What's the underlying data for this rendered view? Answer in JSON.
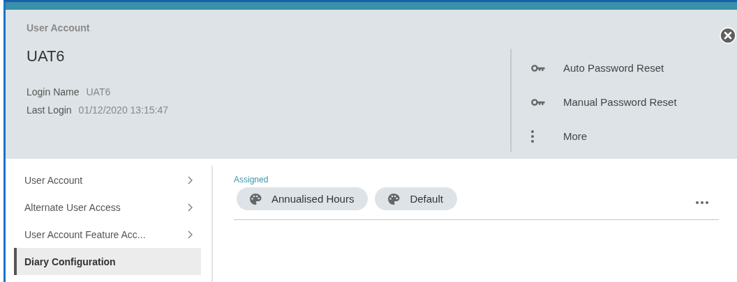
{
  "header": {
    "section": "User Account",
    "name": "UAT6",
    "fields": [
      {
        "label": "Login Name",
        "value": "UAT6"
      },
      {
        "label": "Last Login",
        "value": "01/12/2020 13:15:47"
      }
    ],
    "actions": [
      {
        "kind": "key",
        "label": "Auto Password Reset"
      },
      {
        "kind": "key",
        "label": "Manual Password Reset"
      },
      {
        "kind": "more",
        "label": "More"
      }
    ]
  },
  "sidebar": {
    "items": [
      {
        "label": "User Account",
        "chevron": true,
        "selected": false
      },
      {
        "label": "Alternate User Access",
        "chevron": true,
        "selected": false
      },
      {
        "label": "User Account Feature Acc...",
        "chevron": true,
        "selected": false
      },
      {
        "label": "Diary Configuration",
        "chevron": false,
        "selected": true
      }
    ]
  },
  "content": {
    "label": "Assigned",
    "chips": [
      {
        "label": "Annualised Hours"
      },
      {
        "label": "Default"
      }
    ]
  }
}
